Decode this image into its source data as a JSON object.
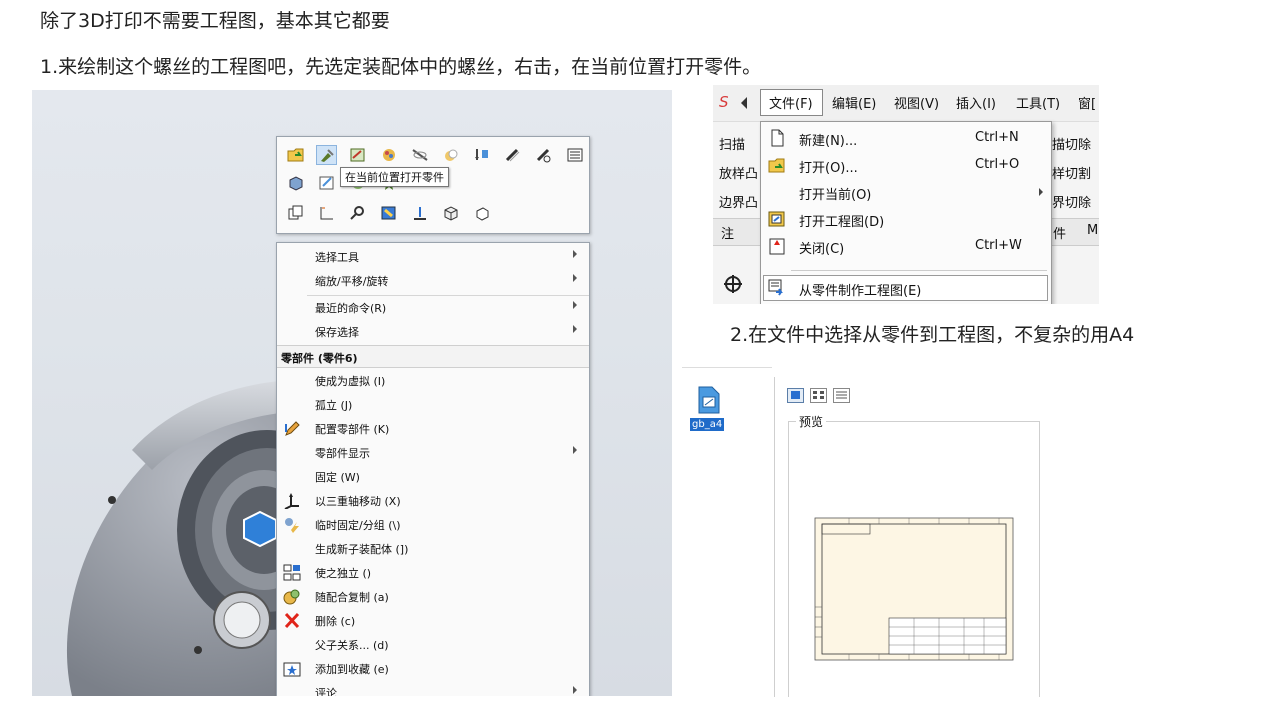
{
  "text": {
    "line1": "除了3D打印不需要工程图，基本其它都要",
    "line2": "1.来绘制这个螺丝的工程图吧，先选定装配体中的螺丝，右击，在当前位置打开零件。",
    "caption2": "2.在文件中选择从零件到工程图，不复杂的用A4"
  },
  "context_toolbar": {
    "tooltip": "在当前位置打开零件"
  },
  "context_menu": {
    "items_top": [
      {
        "label": "选择工具",
        "submenu": true
      },
      {
        "label": "缩放/平移/旋转",
        "submenu": true
      },
      {
        "label": "最近的命令(R)",
        "submenu": true
      },
      {
        "label": "保存选择",
        "submenu": true
      }
    ],
    "section_header": "零部件 (零件6)",
    "items_bottom": [
      {
        "label": "使成为虚拟 (I)",
        "icon": "none"
      },
      {
        "label": "孤立 (J)",
        "icon": "none"
      },
      {
        "label": "配置零部件 (K)",
        "icon": "pencil-icon"
      },
      {
        "label": "零部件显示",
        "icon": "none",
        "submenu": true
      },
      {
        "label": "固定 (W)",
        "icon": "none"
      },
      {
        "label": "以三重轴移动 (X)",
        "icon": "triad-icon"
      },
      {
        "label": "临时固定/分组 (\\)",
        "icon": "temp-fix-icon"
      },
      {
        "label": "生成新子装配体 (])",
        "icon": "none"
      },
      {
        "label": "使之独立 ()",
        "icon": "make-independent-icon"
      },
      {
        "label": "随配合复制 (a)",
        "icon": "copy-mates-icon"
      },
      {
        "label": "删除 (c)",
        "icon": "delete-icon"
      },
      {
        "label": "父子关系... (d)",
        "icon": "none"
      },
      {
        "label": "添加到收藏 (e)",
        "icon": "favorite-icon"
      },
      {
        "label": "评论",
        "icon": "none",
        "submenu": true
      }
    ]
  },
  "menu_shot": {
    "menubar": {
      "logo": "S",
      "file": "文件(F)",
      "edit": "编辑(E)",
      "view": "视图(V)",
      "insert": "插入(I)",
      "tools": "工具(T)",
      "window": "窗["
    },
    "side_left": [
      "扫描",
      "放样凸",
      "边界凸",
      "注"
    ],
    "side_right": [
      "描切除",
      "样切割",
      "界切除",
      "件",
      "M"
    ],
    "dropdown": [
      {
        "label": "新建(N)...",
        "shortcut": "Ctrl+N",
        "icon": "new-doc-icon"
      },
      {
        "label": "打开(O)...",
        "shortcut": "Ctrl+O",
        "icon": "open-folder-icon"
      },
      {
        "label": "打开当前(O)",
        "shortcut": "",
        "icon": "none",
        "submenu": true
      },
      {
        "label": "打开工程图(D)",
        "shortcut": "",
        "icon": "drawing-icon"
      },
      {
        "label": "关闭(C)",
        "shortcut": "Ctrl+W",
        "icon": "close-doc-icon"
      },
      {
        "label": "从零件制作工程图(E)",
        "shortcut": "",
        "icon": "make-drawing-icon"
      }
    ]
  },
  "template_shot": {
    "file_label": "gb_a4",
    "preview_label": "预览"
  },
  "colors": {
    "accent": "#1f6bc9",
    "delete_red": "#e0241a",
    "model_gray": "#8a8f98",
    "paper": "#fdf6e4"
  }
}
